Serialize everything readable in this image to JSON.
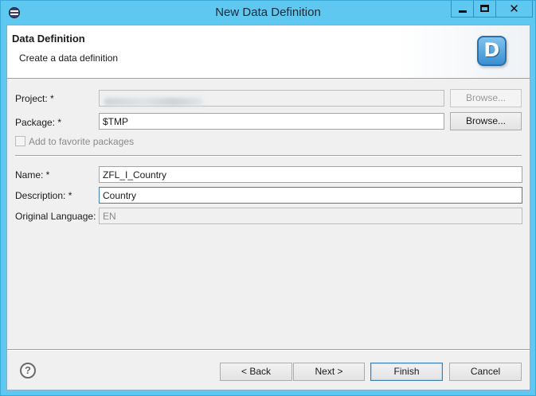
{
  "window": {
    "title": "New Data Definition",
    "app_icon": "eclipse-icon",
    "controls": {
      "minimize": "minimize-icon",
      "maximize": "maximize-icon",
      "close_glyph": "✕"
    }
  },
  "banner": {
    "title": "Data Definition",
    "message": "Create a data definition",
    "logo_letter": "D"
  },
  "form": {
    "project": {
      "label": "Project: *",
      "value": "",
      "browse_label": "Browse..."
    },
    "package": {
      "label": "Package: *",
      "value": "$TMP",
      "browse_label": "Browse..."
    },
    "favorite": {
      "label": "Add to favorite packages",
      "checked": false
    },
    "name": {
      "label": "Name: *",
      "value": "ZFL_I_Country"
    },
    "description": {
      "label": "Description: *",
      "value": "Country"
    },
    "original_language": {
      "label": "Original Language:",
      "value": "EN"
    }
  },
  "footer": {
    "help_glyph": "?",
    "back_label": "< Back",
    "next_label": "Next >",
    "finish_label": "Finish",
    "cancel_label": "Cancel"
  },
  "colors": {
    "titlebar": "#5fc8f0",
    "banner_bg": "#ffffff",
    "dialog_bg": "#f0f0f0",
    "focus_border": "#3c7fb1"
  }
}
